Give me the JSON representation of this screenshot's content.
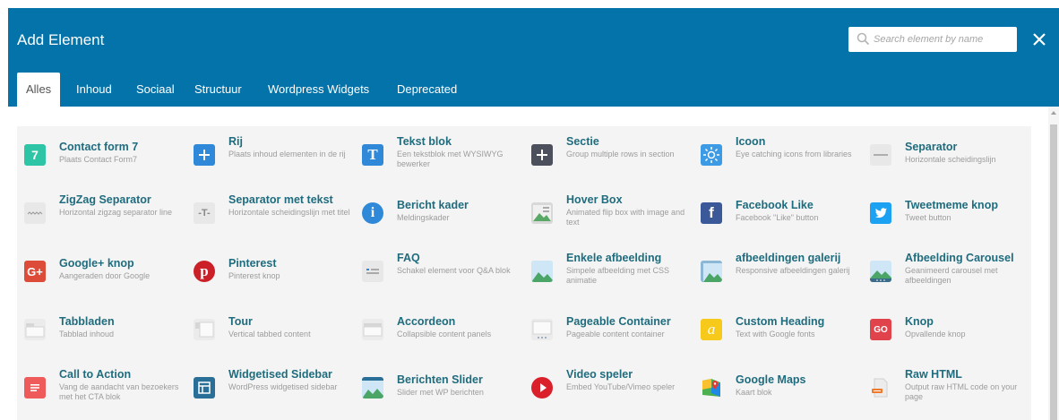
{
  "header": {
    "title": "Add Element",
    "search_placeholder": "Search element by name"
  },
  "tabs": [
    "Alles",
    "Inhoud",
    "Sociaal",
    "Structuur",
    "Wordpress Widgets",
    "Deprecated"
  ],
  "active_tab": "Alles",
  "colors": {
    "header": "#0473aa",
    "title_text": "#1f6c7e",
    "desc_text": "#9c9c9c"
  },
  "elements": [
    {
      "name": "Contact form 7",
      "desc": "Plaats Contact Form7",
      "icon": "contact-form-icon"
    },
    {
      "name": "Rij",
      "desc": "Plaats inhoud elementen in de rij",
      "icon": "row-plus-icon"
    },
    {
      "name": "Tekst blok",
      "desc": "Een tekstblok met WYSIWYG bewerker",
      "icon": "text-block-icon"
    },
    {
      "name": "Sectie",
      "desc": "Group multiple rows in section",
      "icon": "section-plus-icon"
    },
    {
      "name": "Icoon",
      "desc": "Eye catching icons from libraries",
      "icon": "sun-icon"
    },
    {
      "name": "Separator",
      "desc": "Horizontale scheidingslijn",
      "icon": "separator-icon"
    },
    {
      "name": "ZigZag Separator",
      "desc": "Horizontal zigzag separator line",
      "icon": "zigzag-icon"
    },
    {
      "name": "Separator met tekst",
      "desc": "Horizontale scheidingslijn met titel",
      "icon": "separator-text-icon"
    },
    {
      "name": "Bericht kader",
      "desc": "Meldingskader",
      "icon": "info-icon"
    },
    {
      "name": "Hover Box",
      "desc": "Animated flip box with image and text",
      "icon": "hover-box-icon"
    },
    {
      "name": "Facebook Like",
      "desc": "Facebook \"Like\" button",
      "icon": "facebook-icon"
    },
    {
      "name": "Tweetmeme knop",
      "desc": "Tweet button",
      "icon": "twitter-icon"
    },
    {
      "name": "Google+ knop",
      "desc": "Aangeraden door Google",
      "icon": "google-plus-icon"
    },
    {
      "name": "Pinterest",
      "desc": "Pinterest knop",
      "icon": "pinterest-icon"
    },
    {
      "name": "FAQ",
      "desc": "Schakel element voor Q&A blok",
      "icon": "faq-icon"
    },
    {
      "name": "Enkele afbeelding",
      "desc": "Simpele afbeelding met CSS animatie",
      "icon": "image-icon"
    },
    {
      "name": "afbeeldingen galerij",
      "desc": "Responsive afbeeldingen galerij",
      "icon": "gallery-icon"
    },
    {
      "name": "Afbeelding Carousel",
      "desc": "Geanimeerd carousel met afbeeldingen",
      "icon": "carousel-icon"
    },
    {
      "name": "Tabbladen",
      "desc": "Tabblad inhoud",
      "icon": "tabs-icon"
    },
    {
      "name": "Tour",
      "desc": "Vertical tabbed content",
      "icon": "tour-icon"
    },
    {
      "name": "Accordeon",
      "desc": "Collapsible content panels",
      "icon": "accordion-icon"
    },
    {
      "name": "Pageable Container",
      "desc": "Pageable content container",
      "icon": "pageable-icon"
    },
    {
      "name": "Custom Heading",
      "desc": "Text with Google fonts",
      "icon": "custom-heading-icon"
    },
    {
      "name": "Knop",
      "desc": "Opvallende knop",
      "icon": "go-button-icon"
    },
    {
      "name": "Call to Action",
      "desc": "Vang de aandacht van bezoekers met het CTA blok",
      "icon": "cta-icon"
    },
    {
      "name": "Widgetised Sidebar",
      "desc": "WordPress widgetised sidebar",
      "icon": "sidebar-icon"
    },
    {
      "name": "Berichten Slider",
      "desc": "Slider met WP berichten",
      "icon": "slider-icon"
    },
    {
      "name": "Video speler",
      "desc": "Embed YouTube/Vimeo speler",
      "icon": "video-play-icon"
    },
    {
      "name": "Google Maps",
      "desc": "Kaart blok",
      "icon": "maps-icon"
    },
    {
      "name": "Raw HTML",
      "desc": "Output raw HTML code on your page",
      "icon": "raw-html-icon"
    }
  ]
}
